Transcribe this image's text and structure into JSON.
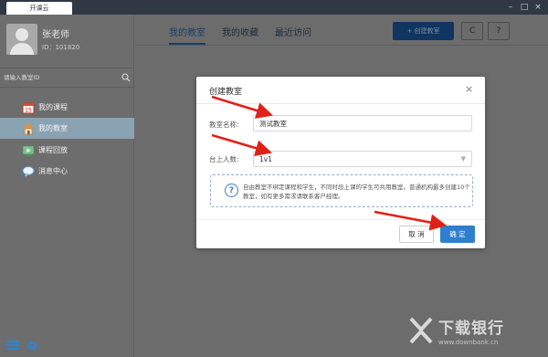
{
  "window": {
    "tab_title": "开课云",
    "controls": [
      "–",
      "□",
      "×"
    ]
  },
  "sidebar": {
    "user": {
      "name": "张老师",
      "id": "ID：101820"
    },
    "search": {
      "placeholder": "请输入教室ID"
    },
    "items": [
      {
        "label": "我的课程",
        "icon": "calendar-icon",
        "active": false
      },
      {
        "label": "我的教室",
        "icon": "house-icon",
        "active": true
      },
      {
        "label": "课程回放",
        "icon": "playback-icon",
        "active": false
      },
      {
        "label": "消息中心",
        "icon": "chat-bubble-icon",
        "active": false
      }
    ],
    "bottom_icons": [
      "list-icon",
      "gear-icon"
    ]
  },
  "main": {
    "tabs": [
      {
        "label": "我的教室",
        "active": true
      },
      {
        "label": "我的收藏",
        "active": false
      },
      {
        "label": "最近访问",
        "active": false
      }
    ],
    "create_button": "+ 创建教室",
    "refresh_button": "C",
    "help_button": "?"
  },
  "dialog": {
    "title": "创建教室",
    "close_label": "×",
    "name_label": "教室名称:",
    "name_value": "测试教室",
    "size_label": "台上人数:",
    "size_value": "1v1",
    "notice_icon": "?",
    "notice_text": "自由教室不绑定课程和学生，不同时段上课的学生可共用教室。普通机构最多创建10个教室，如有更多需求请联系客户经理。",
    "cancel_label": "取 消",
    "confirm_label": "确 定"
  },
  "watermark": {
    "title": "下载银行",
    "url": "www.downbank.cn"
  },
  "colors": {
    "accent": "#2f7fd0",
    "arrow": "#e0211a",
    "active_nav": "#8aa3b3"
  }
}
